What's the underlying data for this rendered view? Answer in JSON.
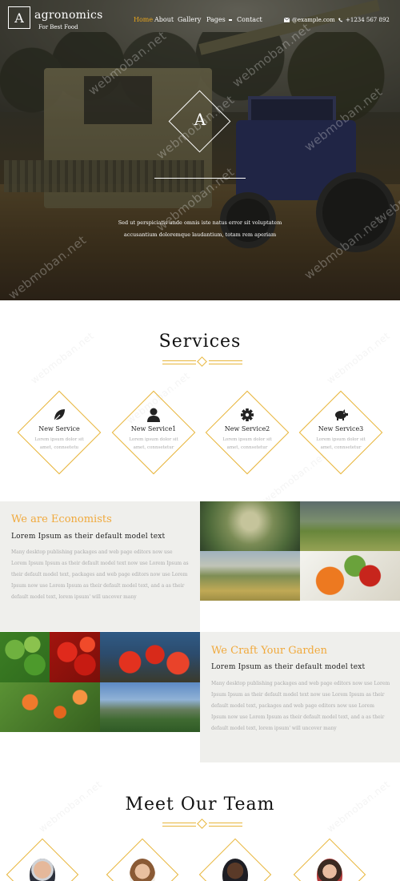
{
  "header": {
    "logo_letter": "A",
    "brand": "agronomics",
    "tagline": "For Best Food",
    "nav": [
      "Home",
      "About",
      "Gallery",
      "Pages",
      "Contact"
    ],
    "email": "@example.com",
    "phone": "+1234 567 892"
  },
  "hero": {
    "letter": "A",
    "line1": "Sed ut perspiciatis unde omnis iste natus error sit voluptatem",
    "line2": "accusantium doloremque laudantium, totam rem aperiam",
    "watermark": "webmoban.net"
  },
  "services": {
    "title": "Services",
    "items": [
      {
        "title": "New Service",
        "desc": "Lorem ipsum dolor sit amet, connsetetu",
        "icon": "leaf-icon"
      },
      {
        "title": "New Service1",
        "desc": "Lorem ipsum dolor sit amet, connsetetur",
        "icon": "user-icon"
      },
      {
        "title": "New Service2",
        "desc": "Lorem ipsum dolor sit amet, connsetetur",
        "icon": "gear-icon"
      },
      {
        "title": "New Service3",
        "desc": "Lorem ipsum dolor sit amet, connsetetur",
        "icon": "piggy-bank-icon"
      }
    ]
  },
  "economists": {
    "title": "We are Economists",
    "subtitle": "Lorem Ipsum as their default model text",
    "body": "Many desktop publishing packages and web page editors now use Lorem Ipsum Ipsum as their default model text now use Lorem Ipsum as their default model text, packages and web page editors now use Lorem Ipsum now use Lorem Ipsum as their default model text, and a as their default model text, lorem ipsum' will uncover many"
  },
  "garden": {
    "title": "We Craft Your Garden",
    "subtitle": "Lorem Ipsum as their default model text",
    "body": "Many desktop publishing packages and web page editors now use Lorem Ipsum Ipsum as their default model text now use Lorem Ipsum as their default model text, packages and web page editors now use Lorem Ipsum now use Lorem Ipsum as their default model text, and a as their default model text, lorem ipsum' will uncover many"
  },
  "team": {
    "title": "Meet Our Team"
  },
  "colors": {
    "accent": "#f0a93c",
    "diamond_border": "#e8b53a",
    "grey_block": "#efefec"
  }
}
